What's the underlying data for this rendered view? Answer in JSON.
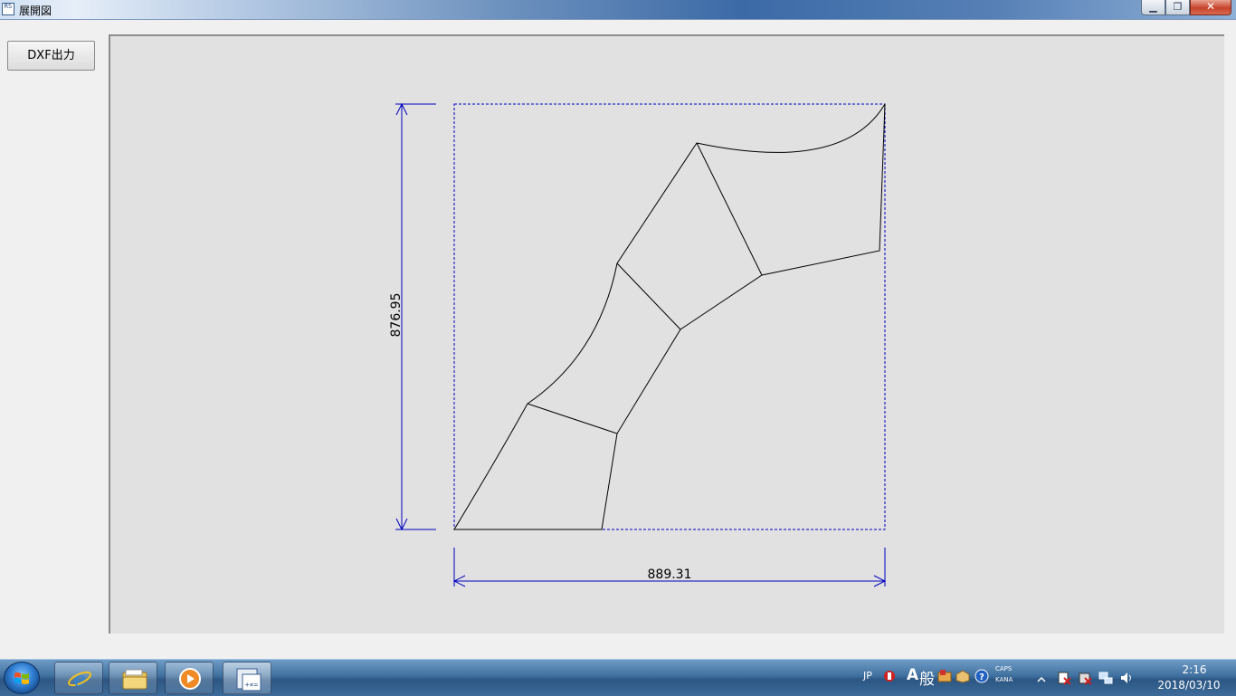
{
  "window": {
    "title": "展開図",
    "app_icon_text": "RS",
    "minimize_glyph": "▁",
    "maximize_glyph": "❐",
    "close_glyph": "✕"
  },
  "toolbar": {
    "dxf_button_label": "DXF出力"
  },
  "drawing": {
    "dimension_width": "889.31",
    "dimension_height": "876.95",
    "line_color": "#000000",
    "dimension_color": "#0000c0"
  },
  "taskbar": {
    "apps": [
      {
        "name": "internet-explorer-icon"
      },
      {
        "name": "file-explorer-icon"
      },
      {
        "name": "media-player-icon"
      },
      {
        "name": "calculator-app-icon"
      }
    ],
    "tray": {
      "language": "JP",
      "ime_mode": "A",
      "ime_kanji": "般",
      "caps": "CAPS",
      "kana": "KANA",
      "time": "2:16",
      "date": "2018/03/10"
    }
  }
}
